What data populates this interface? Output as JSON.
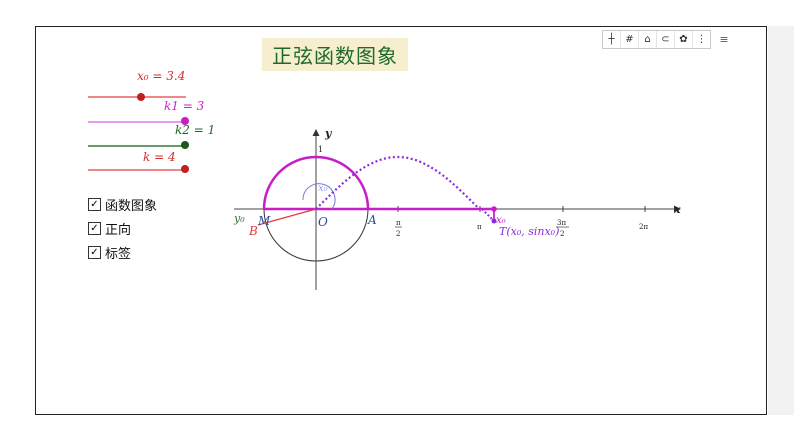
{
  "title": "正弦函数图象",
  "toolbar": {
    "icons": [
      "move-graphics-icon",
      "grid-icon",
      "home-icon",
      "undo-icon",
      "settings-icon",
      "more-icon",
      "style-bar-icon"
    ],
    "glyphs": [
      "┼",
      "#",
      "⌂",
      "⊂",
      "✿",
      "⋮",
      "≡"
    ]
  },
  "sliders": [
    {
      "name": "x0",
      "label": "x₀ = 3.4",
      "color": "#d22c2c",
      "value_fraction": 0.56
    },
    {
      "name": "k1",
      "label": "k1 = 3",
      "color": "#d21ed2",
      "value_fraction": 1.0
    },
    {
      "name": "k2",
      "label": "k2 = 1",
      "color": "#1b6b1b",
      "value_fraction": 1.0
    },
    {
      "name": "k",
      "label": "k = 4",
      "color": "#d22c2c",
      "value_fraction": 1.0
    }
  ],
  "checkboxes": [
    {
      "label": "函数图象",
      "checked": true
    },
    {
      "label": "正向",
      "checked": true
    },
    {
      "label": "标签",
      "checked": true
    }
  ],
  "graph": {
    "axis_x_label": "x",
    "axis_y_label": "y",
    "y_tick_label": "1",
    "origin_label": "O",
    "point_A": "A",
    "point_B": "B",
    "point_M": "M",
    "y0_label": "y₀",
    "x0_arc_label": "x₀",
    "x0_axis_label": "x₀",
    "point_T_label": "T(x₀, sinx₀)",
    "x_ticks": [
      {
        "num": "π",
        "den": "2"
      },
      {
        "text": "π"
      },
      {
        "num": "3π",
        "den": "2"
      },
      {
        "text": "2π"
      }
    ],
    "x0_value": 3.4,
    "colors": {
      "circle": "#333333",
      "arc": "#c81ec8",
      "sine": "#8a2be2",
      "radius": "#e03c3c",
      "green": "#2a7a2a"
    }
  }
}
